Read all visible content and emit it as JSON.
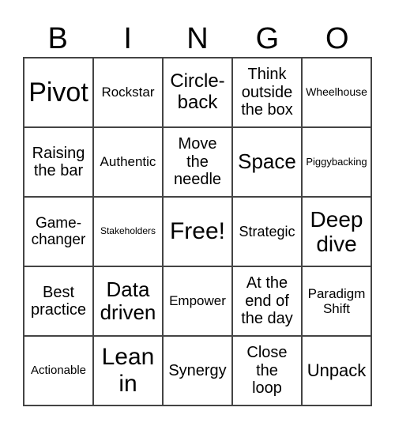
{
  "header": {
    "letters": [
      "B",
      "I",
      "N",
      "G",
      "O"
    ]
  },
  "cells": [
    "Pivot",
    "Rockstar",
    "Circle-\nback",
    "Think\noutside\nthe box",
    "Wheelhouse",
    "Raising\nthe bar",
    "Authentic",
    "Move\nthe\nneedle",
    "Space",
    "Piggybacking",
    "Game-\nchanger",
    "Stakeholders",
    "Free!",
    "Strategic",
    "Deep\ndive",
    "Best\npractice",
    "Data\ndriven",
    "Empower",
    "At the\nend of\nthe day",
    "Paradigm\nShift",
    "Actionable",
    "Lean\nin",
    "Synergy",
    "Close\nthe\nloop",
    "Unpack"
  ]
}
